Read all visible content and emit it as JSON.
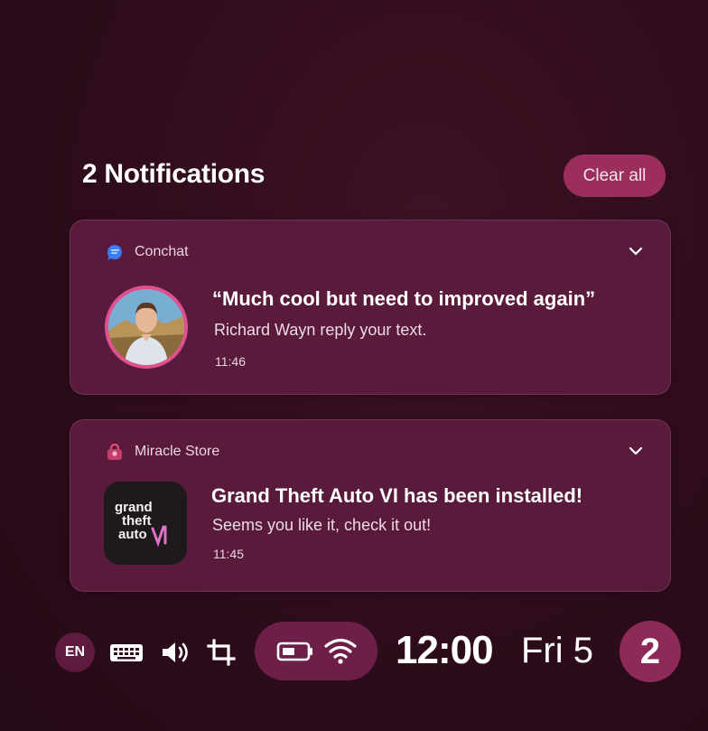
{
  "header": {
    "title": "2 Notifications",
    "clear_label": "Clear all"
  },
  "notifications": [
    {
      "app": "Conchat",
      "app_icon": "chat-bubble-icon",
      "title": "“Much cool but need to improved again”",
      "message": "Richard Wayn reply your text.",
      "time": "11:46"
    },
    {
      "app": "Miracle Store",
      "app_icon": "store-bag-icon",
      "title": "Grand Theft Auto VI has been installed!",
      "message": "Seems you like it, check it out!",
      "time": "11:45",
      "logo_lines": [
        "grand",
        "theft",
        "auto"
      ]
    }
  ],
  "taskbar": {
    "language": "EN",
    "clock": "12:00",
    "date": "Fri 5",
    "notification_count": "2"
  },
  "colors": {
    "background": "#2e0c1b",
    "card": "#5a1a3c",
    "accent": "#9b2e5c",
    "avatar_ring": "#e0508f"
  }
}
